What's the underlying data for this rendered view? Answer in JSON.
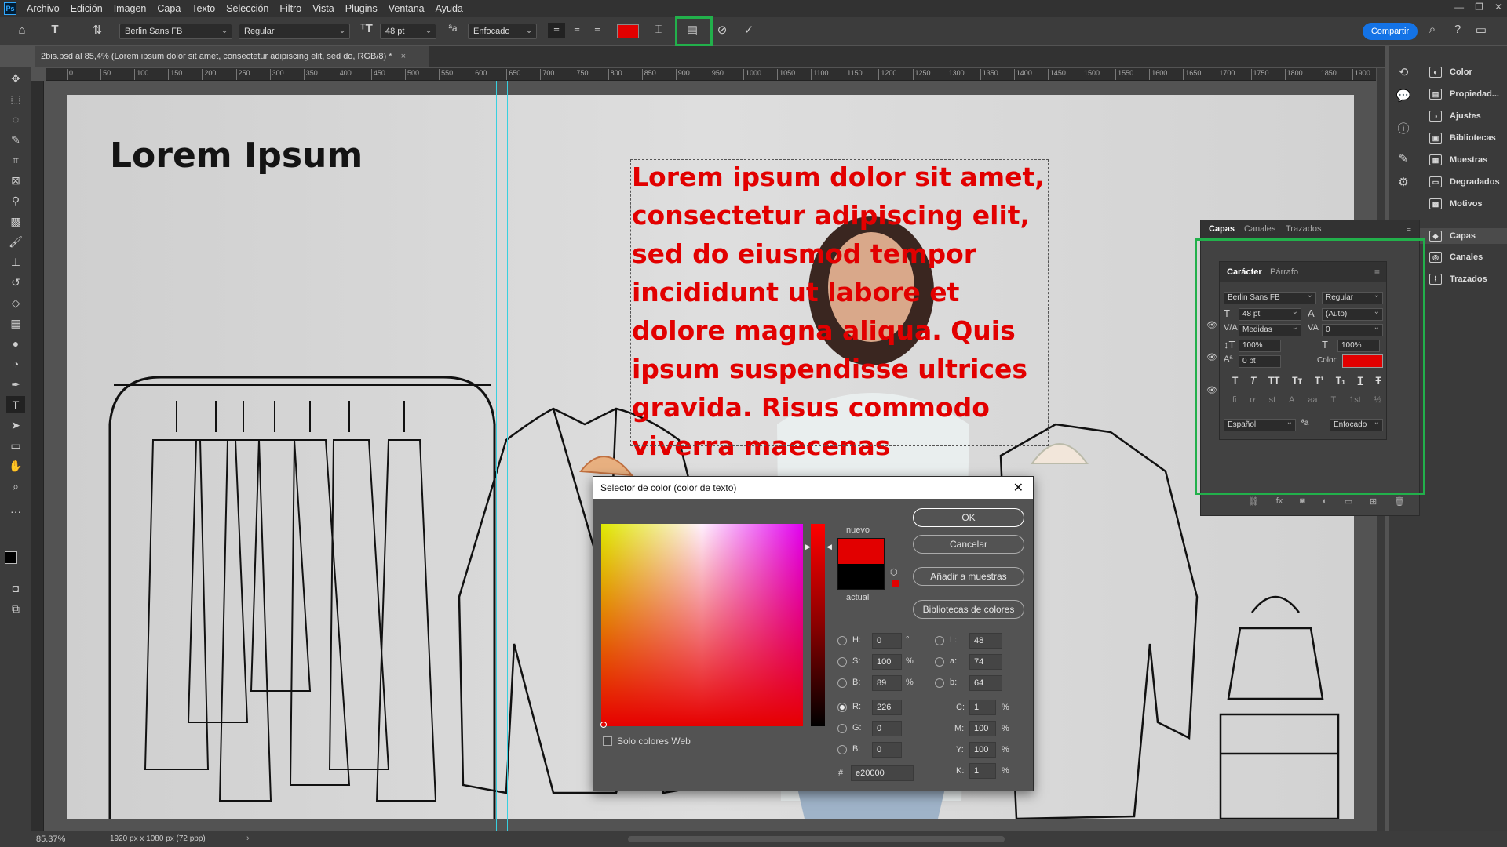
{
  "menu": [
    "Archivo",
    "Edición",
    "Imagen",
    "Capa",
    "Texto",
    "Selección",
    "Filtro",
    "Vista",
    "Plugins",
    "Ventana",
    "Ayuda"
  ],
  "app_logo": "Ps",
  "options": {
    "font_family": "Berlin Sans FB",
    "font_style": "Regular",
    "font_size": "48 pt",
    "antialias": "Enfocado",
    "text_color": "#e20000",
    "share_label": "Compartir"
  },
  "document_tab": "2bis.psd al 85,4% (Lorem ipsum dolor sit amet, consectetur adipiscing elit, sed do, RGB/8) *",
  "ruler_ticks": [
    "0",
    "50",
    "100",
    "150",
    "200",
    "250",
    "300",
    "350",
    "400",
    "450",
    "500",
    "550",
    "600",
    "650",
    "700",
    "750",
    "800",
    "850",
    "900",
    "950",
    "1000",
    "1050",
    "1100",
    "1150",
    "1200",
    "1250",
    "1300",
    "1350",
    "1400",
    "1450",
    "1500",
    "1550",
    "1600",
    "1650",
    "1700",
    "1750",
    "1800",
    "1850",
    "1900"
  ],
  "canvas": {
    "title": "Lorem Ipsum",
    "body_text": "Lorem ipsum dolor sit amet, consectetur adipiscing elit, sed do eiusmod tempor incididunt ut labore et dolore magna aliqua. Quis ipsum suspendisse ultrices gravida. Risus commodo viverra maecenas"
  },
  "status": {
    "zoom": "85.37%",
    "doc_size": "1920 px x 1080 px (72 ppp)"
  },
  "right_panels": [
    "Color",
    "Propiedad...",
    "Ajustes",
    "Bibliotecas",
    "Muestras",
    "Degradados",
    "Motivos",
    "Capas",
    "Canales",
    "Trazados"
  ],
  "layers_panel": {
    "tabs": [
      "Capas",
      "Canales",
      "Trazados"
    ]
  },
  "character_panel": {
    "tabs": [
      "Carácter",
      "Párrafo"
    ],
    "font_family": "Berlin Sans FB",
    "font_style": "Regular",
    "size": "48 pt",
    "leading": "(Auto)",
    "kerning": "Medidas",
    "tracking": "0",
    "vscale": "100%",
    "hscale": "100%",
    "baseline": "0 pt",
    "color_label": "Color:",
    "color": "#e20000",
    "language": "Español",
    "antialias": "Enfocado"
  },
  "color_picker": {
    "title": "Selector de color (color de texto)",
    "new_label": "nuevo",
    "current_label": "actual",
    "buttons": {
      "ok": "OK",
      "cancel": "Cancelar",
      "add": "Añadir a muestras",
      "libs": "Bibliotecas de colores"
    },
    "web_only": "Solo colores Web",
    "H": "0",
    "S": "100",
    "Bv": "89",
    "R": "226",
    "G": "0",
    "B": "0",
    "L": "48",
    "a": "74",
    "b": "64",
    "C": "1",
    "M": "100",
    "Y": "100",
    "K": "1",
    "hex": "e20000",
    "deg": "°",
    "pct": "%",
    "hash": "#",
    "labels": {
      "H": "H:",
      "S": "S:",
      "Bv": "B:",
      "R": "R:",
      "G": "G:",
      "B": "B:",
      "L": "L:",
      "a": "a:",
      "b": "b:",
      "C": "C:",
      "M": "M:",
      "Y": "Y:",
      "K": "K:"
    }
  }
}
